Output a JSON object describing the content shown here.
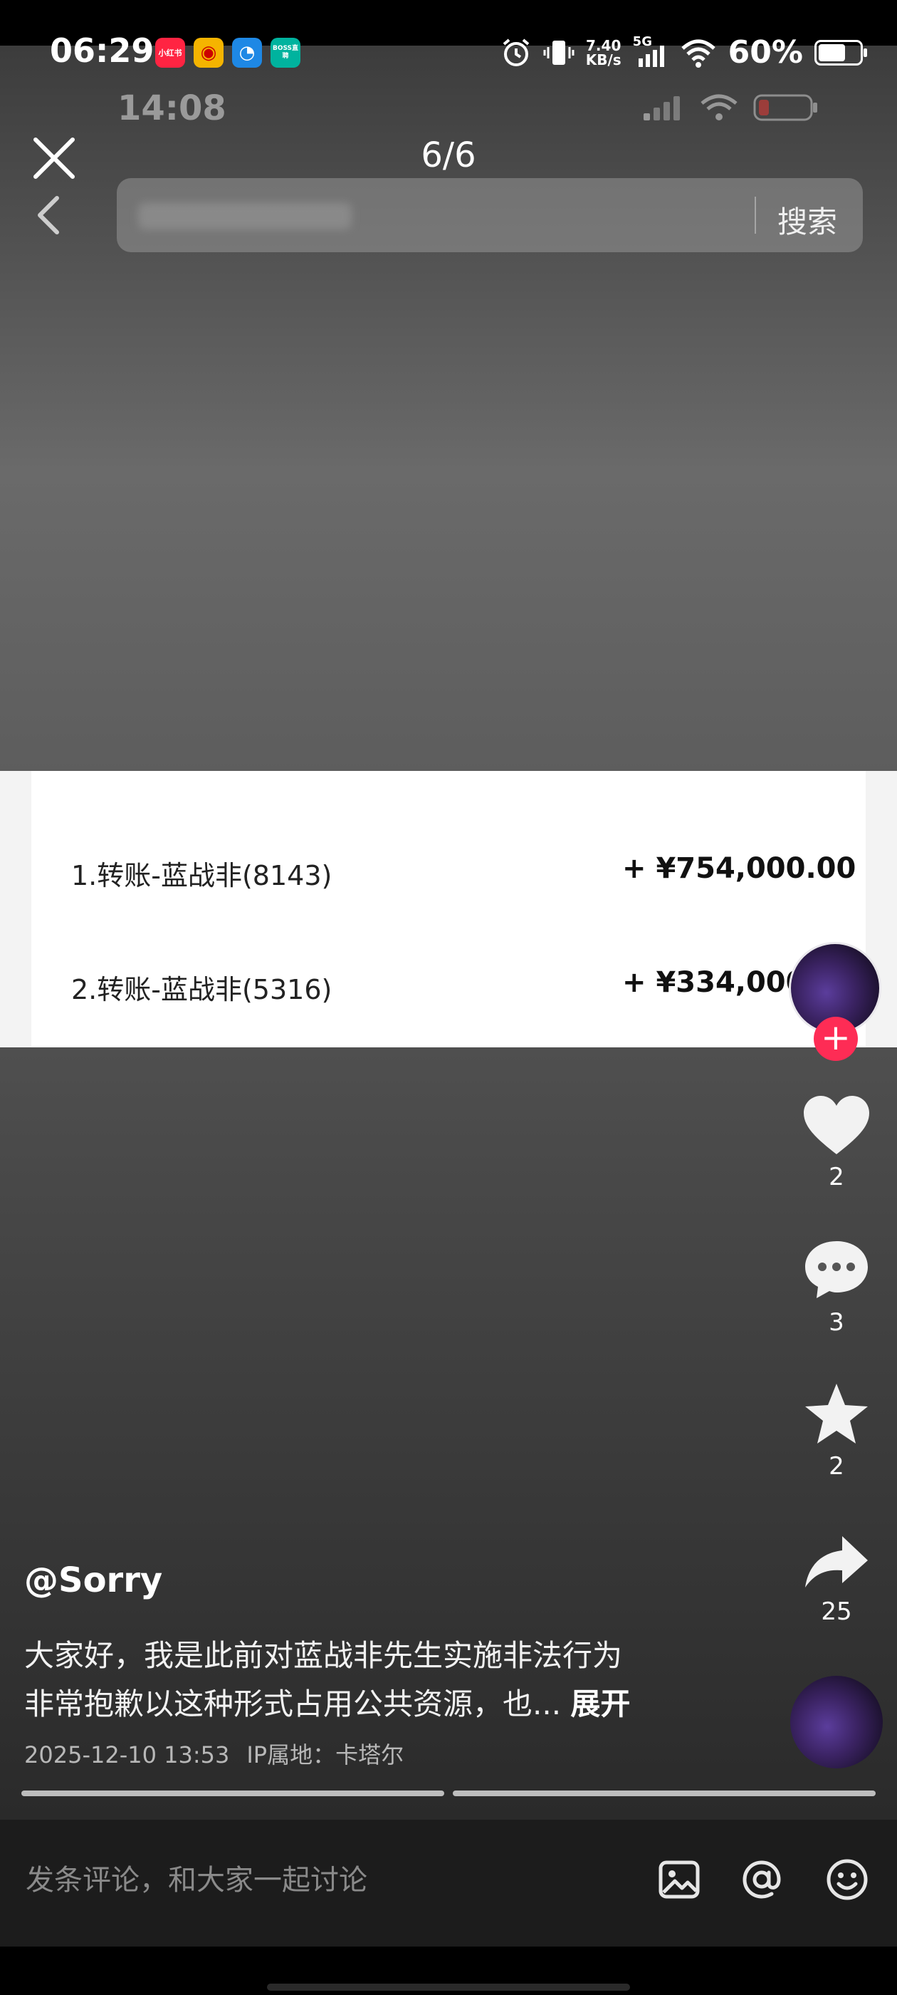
{
  "status_bar": {
    "time": "06:29",
    "apps": [
      {
        "name": "xiaohongshu-icon",
        "label": "小红书",
        "color": "#ff2442"
      },
      {
        "name": "weibo-icon",
        "label": "微博",
        "color": "#f5b400"
      },
      {
        "name": "browser-icon",
        "label": "◔",
        "color": "#1e88e5"
      },
      {
        "name": "boss-icon",
        "label": "BOSS直聘",
        "color": "#00b39e"
      }
    ],
    "net_speed_value": "7.40",
    "net_speed_unit": "KB/s",
    "network": "5G",
    "battery": "60%"
  },
  "screenshot": {
    "time": "14:08"
  },
  "viewer": {
    "counter": "6/6",
    "search_button": "搜索"
  },
  "transactions": [
    {
      "label": "1.转账-蓝战非(8143)",
      "amount": "+ ¥754,000.00"
    },
    {
      "label": "2.转账-蓝战非(5316)",
      "amount": "+ ¥334,000."
    }
  ],
  "actions": {
    "likes": "2",
    "comments": "3",
    "favorites": "2",
    "shares": "25"
  },
  "post": {
    "author": "@Sorry",
    "caption_line1": "大家好，我是此前对蓝战非先生实施非法行为",
    "caption_line2": "非常抱歉以这种形式占用公共资源，也...",
    "expand": "展开",
    "date": "2025-12-10 13:53",
    "ip": "IP属地：卡塔尔"
  },
  "comment_bar": {
    "placeholder": "发条评论，和大家一起讨论"
  },
  "colors": {
    "follow_plus": "#fe2c55"
  }
}
